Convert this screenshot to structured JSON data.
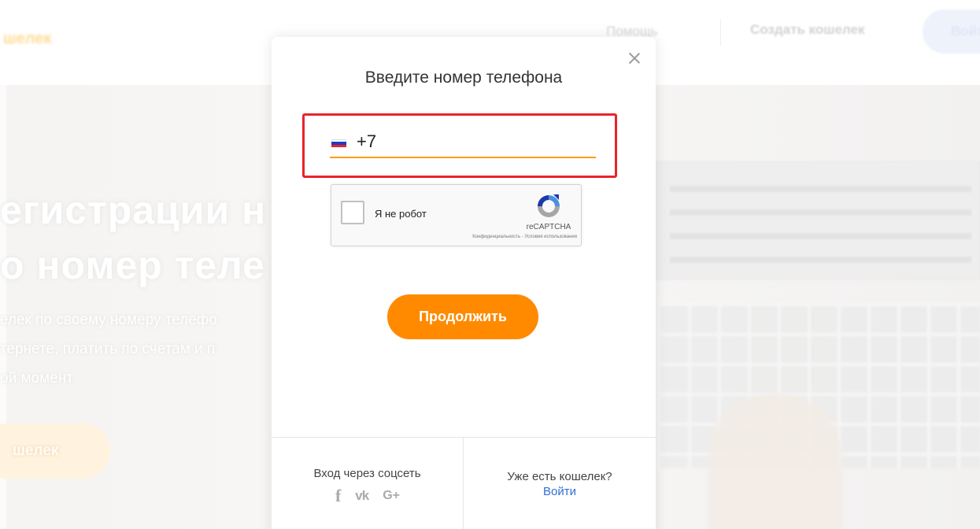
{
  "background": {
    "logo": "шелек",
    "nav": {
      "help": "Помощь",
      "create_wallet": "Создать кошелек",
      "login": "Войти"
    },
    "hero": {
      "title_line1": "егистрации н",
      "title_line2": "о номер теле",
      "text_line1": "елек по своему номеру телефо",
      "text_line2": "тернете, платить по счетам и п",
      "text_line3": "ой момент",
      "button": "шелек"
    }
  },
  "modal": {
    "title": "Введите номер телефона",
    "close_icon": "close-icon",
    "phone": {
      "country_flag": "ru-flag-icon",
      "prefix": "+7",
      "value": "",
      "placeholder": "+7"
    },
    "recaptcha": {
      "label": "Я не робот",
      "brand": "reCAPTCHA",
      "links": "Конфиденциальность - Условия использования"
    },
    "continue_label": "Продолжить",
    "footer": {
      "social_label": "Вход через соцсеть",
      "social_icons": [
        "facebook-icon",
        "vk-icon",
        "google-plus-icon"
      ],
      "has_wallet": "Уже есть кошелек?",
      "login_link": "Войти"
    }
  },
  "colors": {
    "accent": "#ff8a00",
    "underline": "#ff9a1a",
    "highlight": "#e8242a",
    "link": "#2f6fd6"
  }
}
